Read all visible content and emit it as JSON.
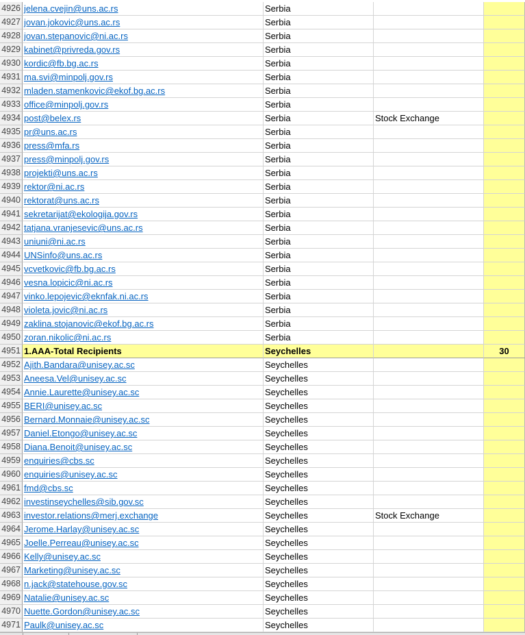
{
  "sheet": {
    "rows": [
      {
        "n": "4926",
        "email": "jelena.cvejin@uns.ac.rs",
        "country": "Serbia",
        "type": "",
        "count": ""
      },
      {
        "n": "4927",
        "email": "jovan.jokovic@uns.ac.rs",
        "country": "Serbia",
        "type": "",
        "count": ""
      },
      {
        "n": "4928",
        "email": "jovan.stepanovic@ni.ac.rs",
        "country": "Serbia",
        "type": "",
        "count": ""
      },
      {
        "n": "4929",
        "email": "kabinet@privreda.gov.rs",
        "country": "Serbia",
        "type": "",
        "count": ""
      },
      {
        "n": "4930",
        "email": "kordic@fb.bg.ac.rs",
        "country": "Serbia",
        "type": "",
        "count": ""
      },
      {
        "n": "4931",
        "email": "ma.svi@minpolj.gov.rs",
        "country": "Serbia",
        "type": "",
        "count": ""
      },
      {
        "n": "4932",
        "email": "mladen.stamenkovic@ekof.bg.ac.rs",
        "country": "Serbia",
        "type": "",
        "count": ""
      },
      {
        "n": "4933",
        "email": "office@minpolj.gov.rs",
        "country": "Serbia",
        "type": "",
        "count": ""
      },
      {
        "n": "4934",
        "email": "post@belex.rs",
        "country": "Serbia",
        "type": "Stock Exchange",
        "count": ""
      },
      {
        "n": "4935",
        "email": "pr@uns.ac.rs",
        "country": "Serbia",
        "type": "",
        "count": ""
      },
      {
        "n": "4936",
        "email": "press@mfa.rs",
        "country": "Serbia",
        "type": "",
        "count": ""
      },
      {
        "n": "4937",
        "email": "press@minpolj.gov.rs",
        "country": "Serbia",
        "type": "",
        "count": ""
      },
      {
        "n": "4938",
        "email": "projekti@uns.ac.rs",
        "country": "Serbia",
        "type": "",
        "count": ""
      },
      {
        "n": "4939",
        "email": "rektor@ni.ac.rs",
        "country": "Serbia",
        "type": "",
        "count": ""
      },
      {
        "n": "4940",
        "email": "rektorat@uns.ac.rs",
        "country": "Serbia",
        "type": "",
        "count": ""
      },
      {
        "n": "4941",
        "email": "sekretarijat@ekologija.gov.rs",
        "country": "Serbia",
        "type": "",
        "count": ""
      },
      {
        "n": "4942",
        "email": "tatjana.vranjesevic@uns.ac.rs",
        "country": "Serbia",
        "type": "",
        "count": ""
      },
      {
        "n": "4943",
        "email": "uniuni@ni.ac.rs",
        "country": "Serbia",
        "type": "",
        "count": ""
      },
      {
        "n": "4944",
        "email": "UNSinfo@uns.ac.rs",
        "country": "Serbia",
        "type": "",
        "count": ""
      },
      {
        "n": "4945",
        "email": "vcvetkovic@fb.bg.ac.rs",
        "country": "Serbia",
        "type": "",
        "count": ""
      },
      {
        "n": "4946",
        "email": "vesna.lopicic@ni.ac.rs",
        "country": "Serbia",
        "type": "",
        "count": ""
      },
      {
        "n": "4947",
        "email": "vinko.lepojevic@eknfak.ni.ac.rs",
        "country": "Serbia",
        "type": "",
        "count": ""
      },
      {
        "n": "4948",
        "email": "violeta.jovic@ni.ac.rs",
        "country": "Serbia",
        "type": "",
        "count": ""
      },
      {
        "n": "4949",
        "email": "zaklina.stojanovic@ekof.bg.ac.rs",
        "country": "Serbia",
        "type": "",
        "count": ""
      },
      {
        "n": "4950",
        "email": "zoran.nikolic@ni.ac.rs",
        "country": "Serbia",
        "type": "",
        "count": ""
      },
      {
        "n": "4951",
        "email": "1.AAA-Total Recipients",
        "country": "Seychelles",
        "type": "",
        "count": "30",
        "total": true
      },
      {
        "n": "4952",
        "email": "Ajith.Bandara@unisey.ac.sc",
        "country": "Seychelles",
        "type": "",
        "count": ""
      },
      {
        "n": "4953",
        "email": "Aneesa.Vel@unisey.ac.sc",
        "country": "Seychelles",
        "type": "",
        "count": ""
      },
      {
        "n": "4954",
        "email": "Annie.Laurette@unisey.ac.sc",
        "country": "Seychelles",
        "type": "",
        "count": ""
      },
      {
        "n": "4955",
        "email": "BERI@unisey.ac.sc",
        "country": "Seychelles",
        "type": "",
        "count": ""
      },
      {
        "n": "4956",
        "email": "Bernard.Monnaie@unisey.ac.sc",
        "country": "Seychelles",
        "type": "",
        "count": ""
      },
      {
        "n": "4957",
        "email": "Daniel.Etongo@unisey.ac.sc",
        "country": "Seychelles",
        "type": "",
        "count": ""
      },
      {
        "n": "4958",
        "email": "Diana.Benoit@unisey.ac.sc",
        "country": "Seychelles",
        "type": "",
        "count": ""
      },
      {
        "n": "4959",
        "email": "enquiries@cbs.sc",
        "country": "Seychelles",
        "type": "",
        "count": ""
      },
      {
        "n": "4960",
        "email": "enquiries@unisey.ac.sc",
        "country": "Seychelles",
        "type": "",
        "count": ""
      },
      {
        "n": "4961",
        "email": "fmd@cbs.sc",
        "country": "Seychelles",
        "type": "",
        "count": ""
      },
      {
        "n": "4962",
        "email": "investinseychelles@sib.gov.sc",
        "country": "Seychelles",
        "type": "",
        "count": ""
      },
      {
        "n": "4963",
        "email": "investor.relations@merj.exchange",
        "country": "Seychelles",
        "type": "Stock Exchange",
        "count": ""
      },
      {
        "n": "4964",
        "email": "Jerome.Harlay@unisey.ac.sc",
        "country": "Seychelles",
        "type": "",
        "count": ""
      },
      {
        "n": "4965",
        "email": "Joelle.Perreau@unisey.ac.sc",
        "country": "Seychelles",
        "type": "",
        "count": ""
      },
      {
        "n": "4966",
        "email": "Kelly@unisey.ac.sc",
        "country": "Seychelles",
        "type": "",
        "count": ""
      },
      {
        "n": "4967",
        "email": "Marketing@unisey.ac.sc",
        "country": "Seychelles",
        "type": "",
        "count": ""
      },
      {
        "n": "4968",
        "email": "n.jack@statehouse.gov.sc",
        "country": "Seychelles",
        "type": "",
        "count": ""
      },
      {
        "n": "4969",
        "email": "Natalie@unisey.ac.sc",
        "country": "Seychelles",
        "type": "",
        "count": ""
      },
      {
        "n": "4970",
        "email": "Nuette.Gordon@unisey.ac.sc",
        "country": "Seychelles",
        "type": "",
        "count": ""
      },
      {
        "n": "4971",
        "email": "Paulk@unisey.ac.sc",
        "country": "Seychelles",
        "type": "",
        "count": ""
      }
    ]
  }
}
